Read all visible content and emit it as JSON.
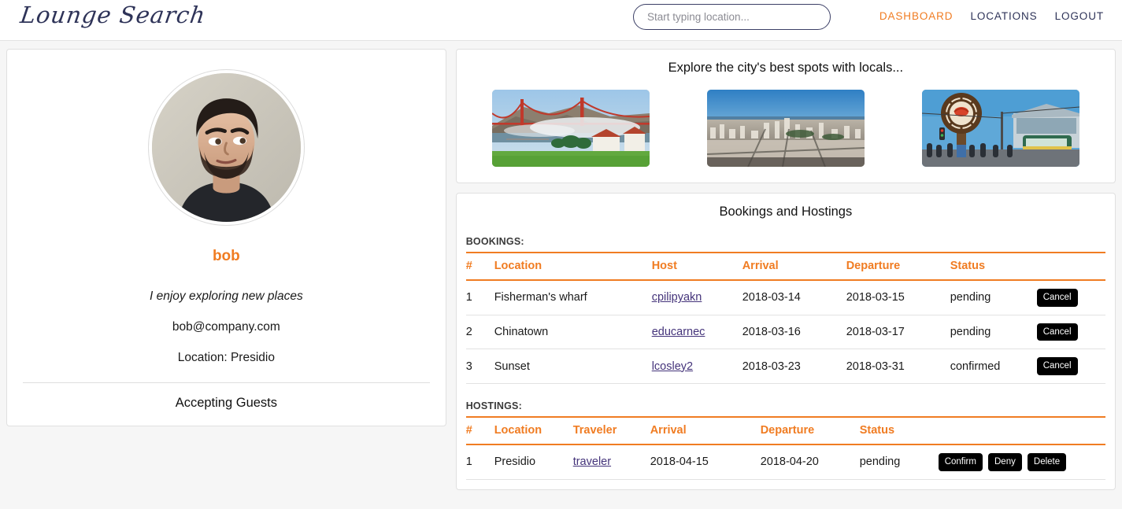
{
  "header": {
    "brand": "Lounge Search",
    "search": {
      "placeholder": "Start typing location...",
      "value": ""
    },
    "nav": [
      {
        "label": "DASHBOARD",
        "active": true
      },
      {
        "label": "LOCATIONS",
        "active": false
      },
      {
        "label": "LOGOUT",
        "active": false
      }
    ]
  },
  "profile": {
    "avatar_alt": "user-photo",
    "name": "bob",
    "tagline": "I enjoy exploring new places",
    "email": "bob@company.com",
    "location": "Location: Presidio",
    "status": "Accepting Guests"
  },
  "explore": {
    "title": "Explore the city's best spots with locals...",
    "thumbnails": [
      {
        "name": "golden-gate-bridge-thumbnail"
      },
      {
        "name": "city-skyline-thumbnail"
      },
      {
        "name": "fishermans-wharf-thumbnail"
      }
    ]
  },
  "bookings_panel": {
    "title": "Bookings and Hostings",
    "bookings": {
      "label": "BOOKINGS:",
      "columns": [
        "#",
        "Location",
        "Host",
        "Arrival",
        "Departure",
        "Status",
        ""
      ],
      "rows": [
        {
          "num": "1",
          "location": "Fisherman's wharf",
          "host": "cpilipyakn",
          "arrival": "2018-03-14",
          "departure": "2018-03-15",
          "status": "pending",
          "action": "Cancel"
        },
        {
          "num": "2",
          "location": "Chinatown",
          "host": "educarnec",
          "arrival": "2018-03-16",
          "departure": "2018-03-17",
          "status": "pending",
          "action": "Cancel"
        },
        {
          "num": "3",
          "location": "Sunset",
          "host": "lcosley2",
          "arrival": "2018-03-23",
          "departure": "2018-03-31",
          "status": "confirmed",
          "action": "Cancel"
        }
      ]
    },
    "hostings": {
      "label": "HOSTINGS:",
      "columns": [
        "#",
        "Location",
        "Traveler",
        "Arrival",
        "Departure",
        "Status",
        ""
      ],
      "rows": [
        {
          "num": "1",
          "location": "Presidio",
          "traveler": "traveler",
          "arrival": "2018-04-15",
          "departure": "2018-04-20",
          "status": "pending",
          "confirm": "Confirm",
          "deny": "Deny",
          "delete": "Delete"
        }
      ]
    }
  },
  "colors": {
    "accent": "#f07c22",
    "navy": "#2e3358",
    "link": "#44337a",
    "button": "#000000",
    "page_bg": "#f6f6f6"
  }
}
